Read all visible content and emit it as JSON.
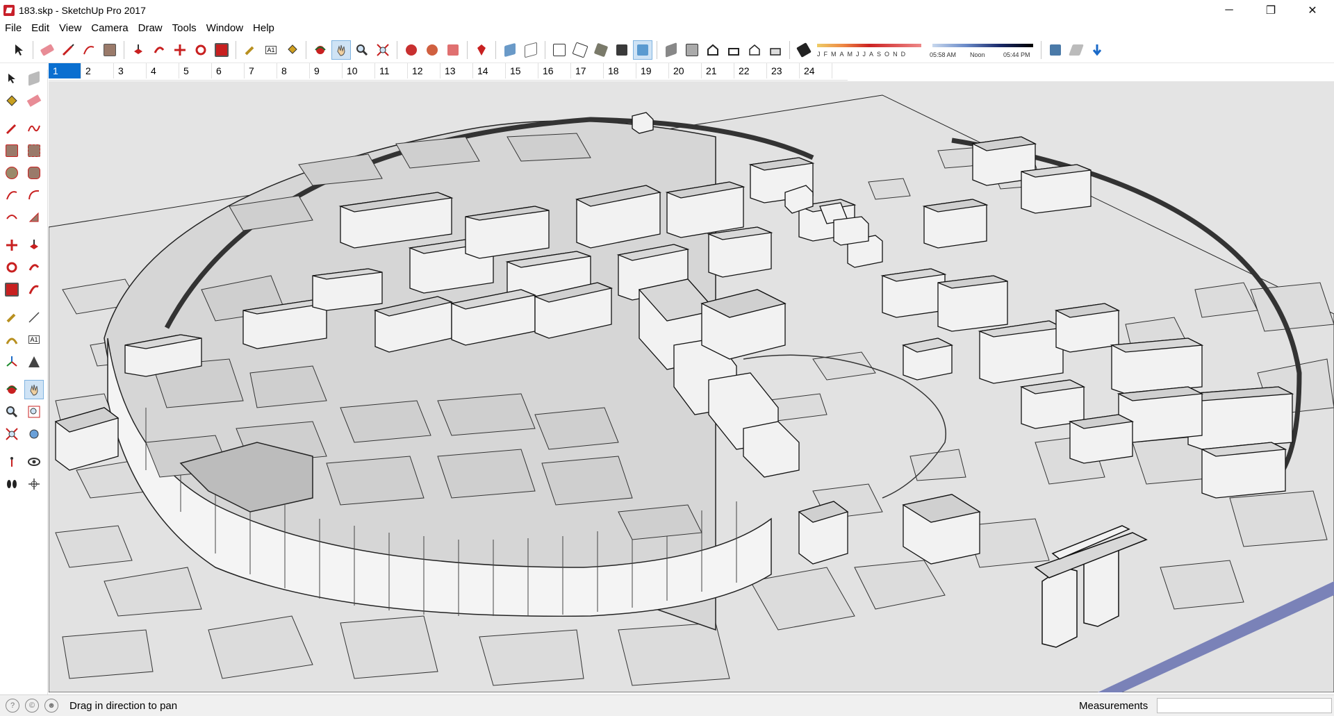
{
  "window": {
    "title": "183.skp - SketchUp Pro 2017",
    "minimize_glyph": "─",
    "restore_glyph": "❐",
    "close_glyph": "✕"
  },
  "menu": [
    "File",
    "Edit",
    "View",
    "Camera",
    "Draw",
    "Tools",
    "Window",
    "Help"
  ],
  "shadow_settings": {
    "months": [
      "J",
      "F",
      "M",
      "A",
      "M",
      "J",
      "J",
      "A",
      "S",
      "O",
      "N",
      "D"
    ],
    "time_start": "05:58 AM",
    "time_mid": "Noon",
    "time_end": "05:44 PM"
  },
  "scenes": [
    "1",
    "2",
    "3",
    "4",
    "5",
    "6",
    "7",
    "8",
    "9",
    "10",
    "11",
    "12",
    "13",
    "14",
    "15",
    "16",
    "17",
    "18",
    "19",
    "20",
    "21",
    "22",
    "23",
    "24"
  ],
  "active_scene": "1",
  "active_tool": "pan",
  "status": {
    "message": "Drag in direction to pan",
    "measurements_label": "Measurements",
    "measurements_value": ""
  },
  "colors": {
    "accent": "#0a6fd0",
    "ground": "#e4e4e4",
    "building_roof": "#d8d8d8",
    "building_wall": "#f2f2f2",
    "edge": "#222222"
  }
}
